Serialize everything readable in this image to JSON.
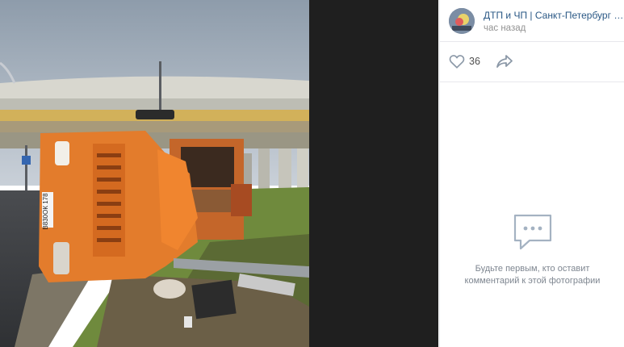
{
  "post": {
    "author": "ДТП и ЧП | Санкт-Петербург | Питер",
    "time": "час назад"
  },
  "actions": {
    "like_count": "36",
    "like_icon": "heart-icon",
    "share_icon": "share-arrow-icon"
  },
  "comments": {
    "empty_icon": "comment-bubble-icon",
    "empty_line1": "Будьте первым, кто оставит",
    "empty_line2": "комментарий к этой фотографии"
  },
  "photo": {
    "plate": "В830ОК 178"
  },
  "colors": {
    "link": "#2a5885",
    "muted": "#939393",
    "viewer_bg": "#1f1f1f"
  }
}
